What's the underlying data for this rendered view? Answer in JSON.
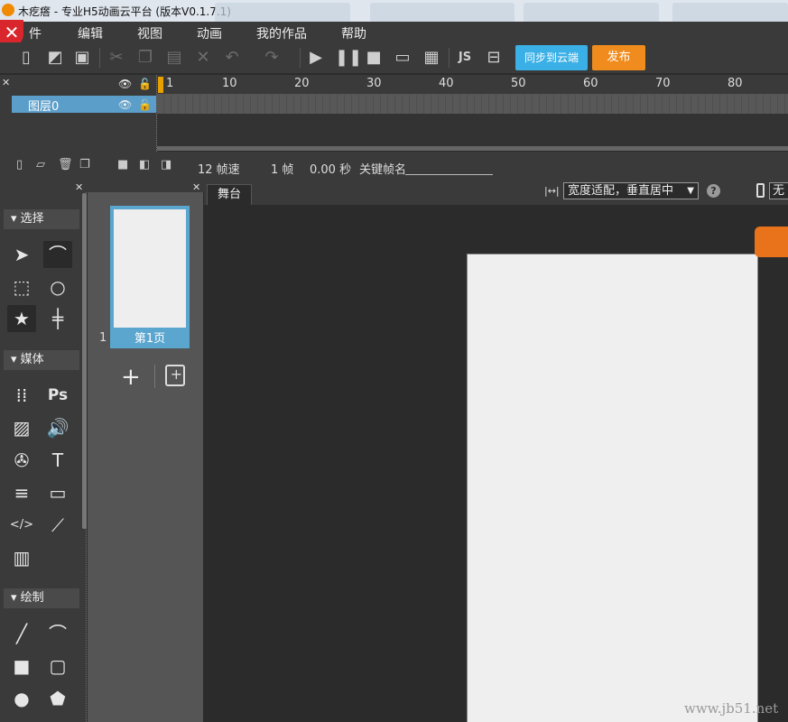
{
  "window": {
    "title": "木疙瘩 - 专业H5动画云平台 (版本V0.1.7.1)"
  },
  "menu": {
    "items": [
      {
        "label": "件",
        "name": "menu-file"
      },
      {
        "label": "编辑",
        "name": "menu-edit"
      },
      {
        "label": "视图",
        "name": "menu-view"
      },
      {
        "label": "动画",
        "name": "menu-animation"
      },
      {
        "label": "我的作品",
        "name": "menu-my-works"
      },
      {
        "label": "帮助",
        "name": "menu-help"
      }
    ]
  },
  "toolbar": {
    "icons": [
      "new-file-icon",
      "open-folder-icon",
      "save-icon",
      "cut-icon",
      "copy-icon",
      "paste-icon",
      "delete-icon",
      "undo-icon",
      "redo-icon",
      "play-icon",
      "pause-icon",
      "stop-icon",
      "preview-icon",
      "qrcode-icon",
      "js-icon",
      "inbox-icon"
    ],
    "sync_label": "同步到云端",
    "publish_label": "发布",
    "colors": {
      "sync": "#3ab0e6",
      "publish": "#f08c1e"
    }
  },
  "timeline": {
    "ruler_numbers": [
      "1",
      "10",
      "20",
      "30",
      "40",
      "50",
      "60",
      "70",
      "80"
    ],
    "layer_name": "图层0",
    "fps_label": "12 帧速",
    "frame_label": "1 帧",
    "time_label": "0.00 秒",
    "keyframe_name_label": "关键帧名",
    "keyframe_name_value": ""
  },
  "tools": {
    "sections": {
      "select": "选择",
      "media": "媒体",
      "draw": "绘制"
    },
    "text_icon_glyph": "T",
    "ps_glyph": "Ps"
  },
  "pages": {
    "items": [
      {
        "number": "1",
        "label": "第1页"
      }
    ]
  },
  "stage": {
    "tab_label": "舞台",
    "fit_mode": "宽度适配，垂直居中",
    "device": "无",
    "help_glyph": "?"
  },
  "watermark": "www.jb51.net"
}
